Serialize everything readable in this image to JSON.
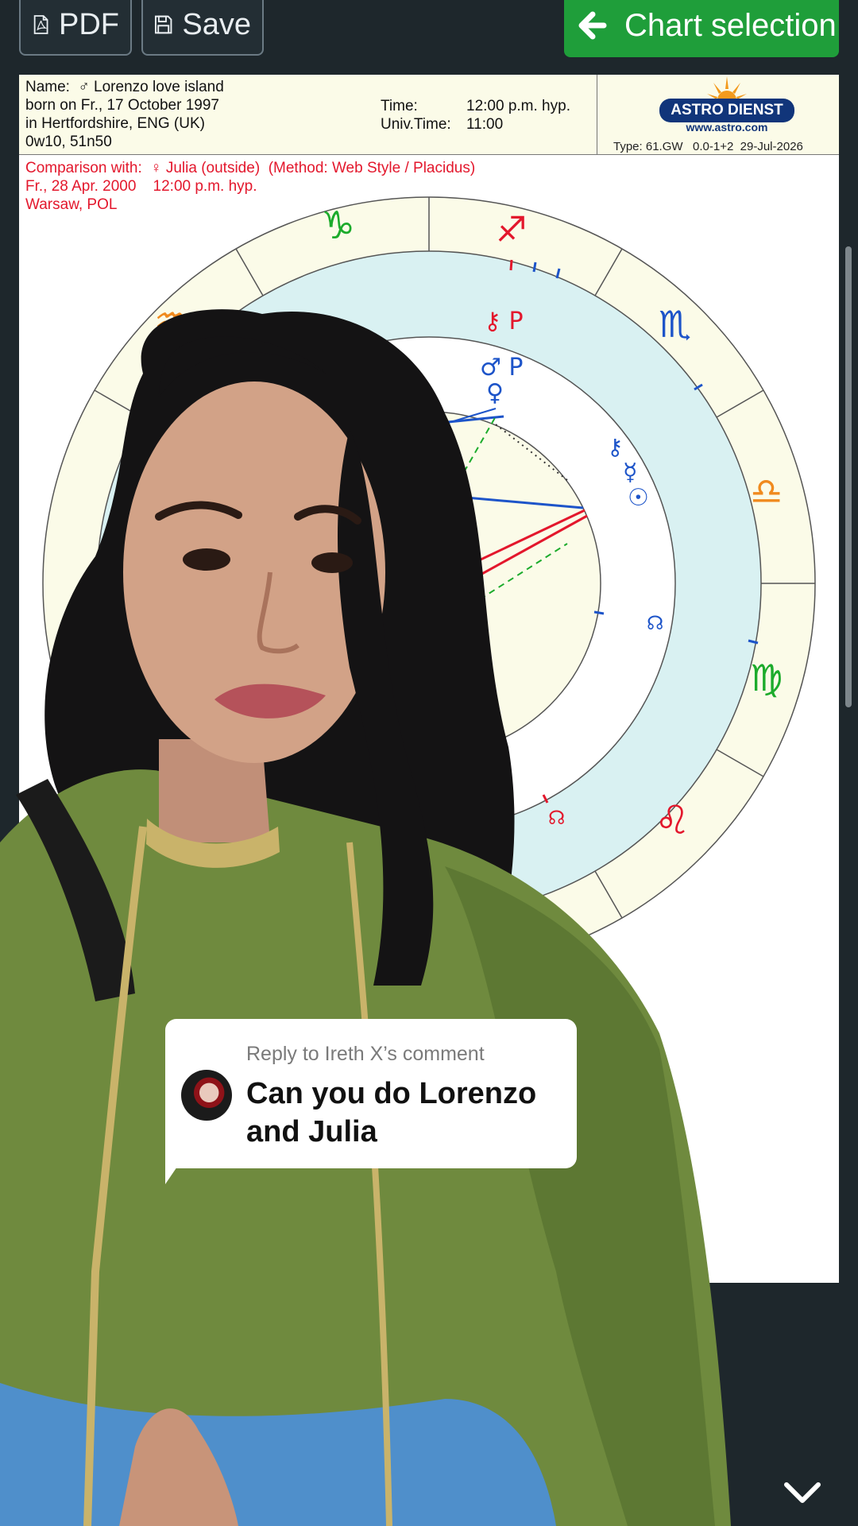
{
  "toolbar": {
    "pdf_label": "PDF",
    "save_label": "Save",
    "chart_selection_label": "Chart selection",
    "accent": "#1f9e3a"
  },
  "chart": {
    "name_line": "Name:  ♂ Lorenzo love island",
    "born_line": "born on Fr., 17 October 1997",
    "place_line": "in Hertfordshire, ENG (UK)",
    "coords_line": "0w10, 51n50",
    "time_label": "Time:",
    "time_value": "12:00 p.m. hyp.",
    "ut_label": "Univ.Time:",
    "ut_value": "11:00",
    "logo_text": "ASTRO DIENST",
    "logo_url": "www.astro.com",
    "type_line": "Type: 61.GW   0.0-1+2  29-Jul-2026",
    "comparison_line": "Comparison with:  ♀ Julia (outside)  (Method: Web Style / Placidus)",
    "comparison_date": "Fr., 28 Apr. 2000    12:00 p.m. hyp.",
    "comparison_place": "Warsaw, POL"
  },
  "comment": {
    "reply_to": "Reply to Ireth X’s comment",
    "text": "Can you do Lorenzo and Julia"
  },
  "icons": [
    "pdf-file-icon",
    "floppy-disk-icon",
    "arrow-left-icon",
    "chevron-down-icon"
  ]
}
